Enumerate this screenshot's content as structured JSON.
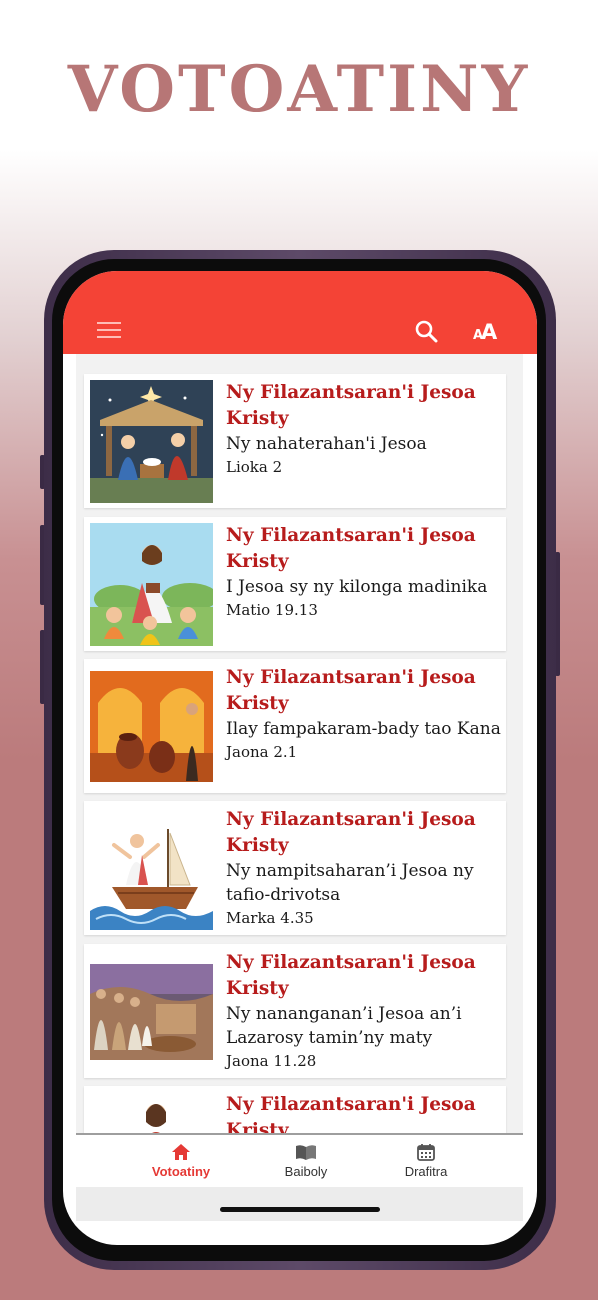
{
  "headline": "VOTOATINY",
  "colors": {
    "accent": "#f44336",
    "title": "#b71c1c",
    "background_bottom": "#bb7b7c"
  },
  "appbar": {
    "menu_icon": "hamburger-menu-icon",
    "search_icon": "search-icon",
    "font_size_icon": "font-size-icon"
  },
  "stories": [
    {
      "title": "Ny Filazantsaran'i Jesoa Kristy",
      "subtitle": "Ny nahaterahan'i Jesoa",
      "reference": "Lioka 2",
      "image": "nativity-scene"
    },
    {
      "title": "Ny Filazantsaran'i Jesoa Kristy",
      "subtitle": "I Jesoa sy ny kilonga madinika",
      "reference": "Matio 19.13",
      "image": "jesus-with-children"
    },
    {
      "title": "Ny Filazantsaran'i Jesoa Kristy",
      "subtitle": "Ilay fampakaram-bady tao Kana",
      "reference": "Jaona 2.1",
      "image": "wedding-at-cana"
    },
    {
      "title": "Ny Filazantsaran'i Jesoa Kristy",
      "subtitle": "Ny nampitsaharan’i Jesoa ny tafio-drivotsa",
      "reference": "Marka 4.35",
      "image": "calming-the-storm"
    },
    {
      "title": "Ny Filazantsaran'i Jesoa Kristy",
      "subtitle": "Ny nananganan’i Jesoa an’i Lazarosy tamin’ny maty",
      "reference": "Jaona 11.28",
      "image": "raising-of-lazarus"
    },
    {
      "title": "Ny Filazantsaran'i Jesoa Kristy",
      "subtitle": "",
      "reference": "",
      "image": "jesus-portrait"
    }
  ],
  "bottom_nav": [
    {
      "label": "Votoatiny",
      "icon": "home-icon",
      "active": true
    },
    {
      "label": "Baiboly",
      "icon": "book-icon",
      "active": false
    },
    {
      "label": "Drafitra",
      "icon": "calendar-icon",
      "active": false
    }
  ]
}
